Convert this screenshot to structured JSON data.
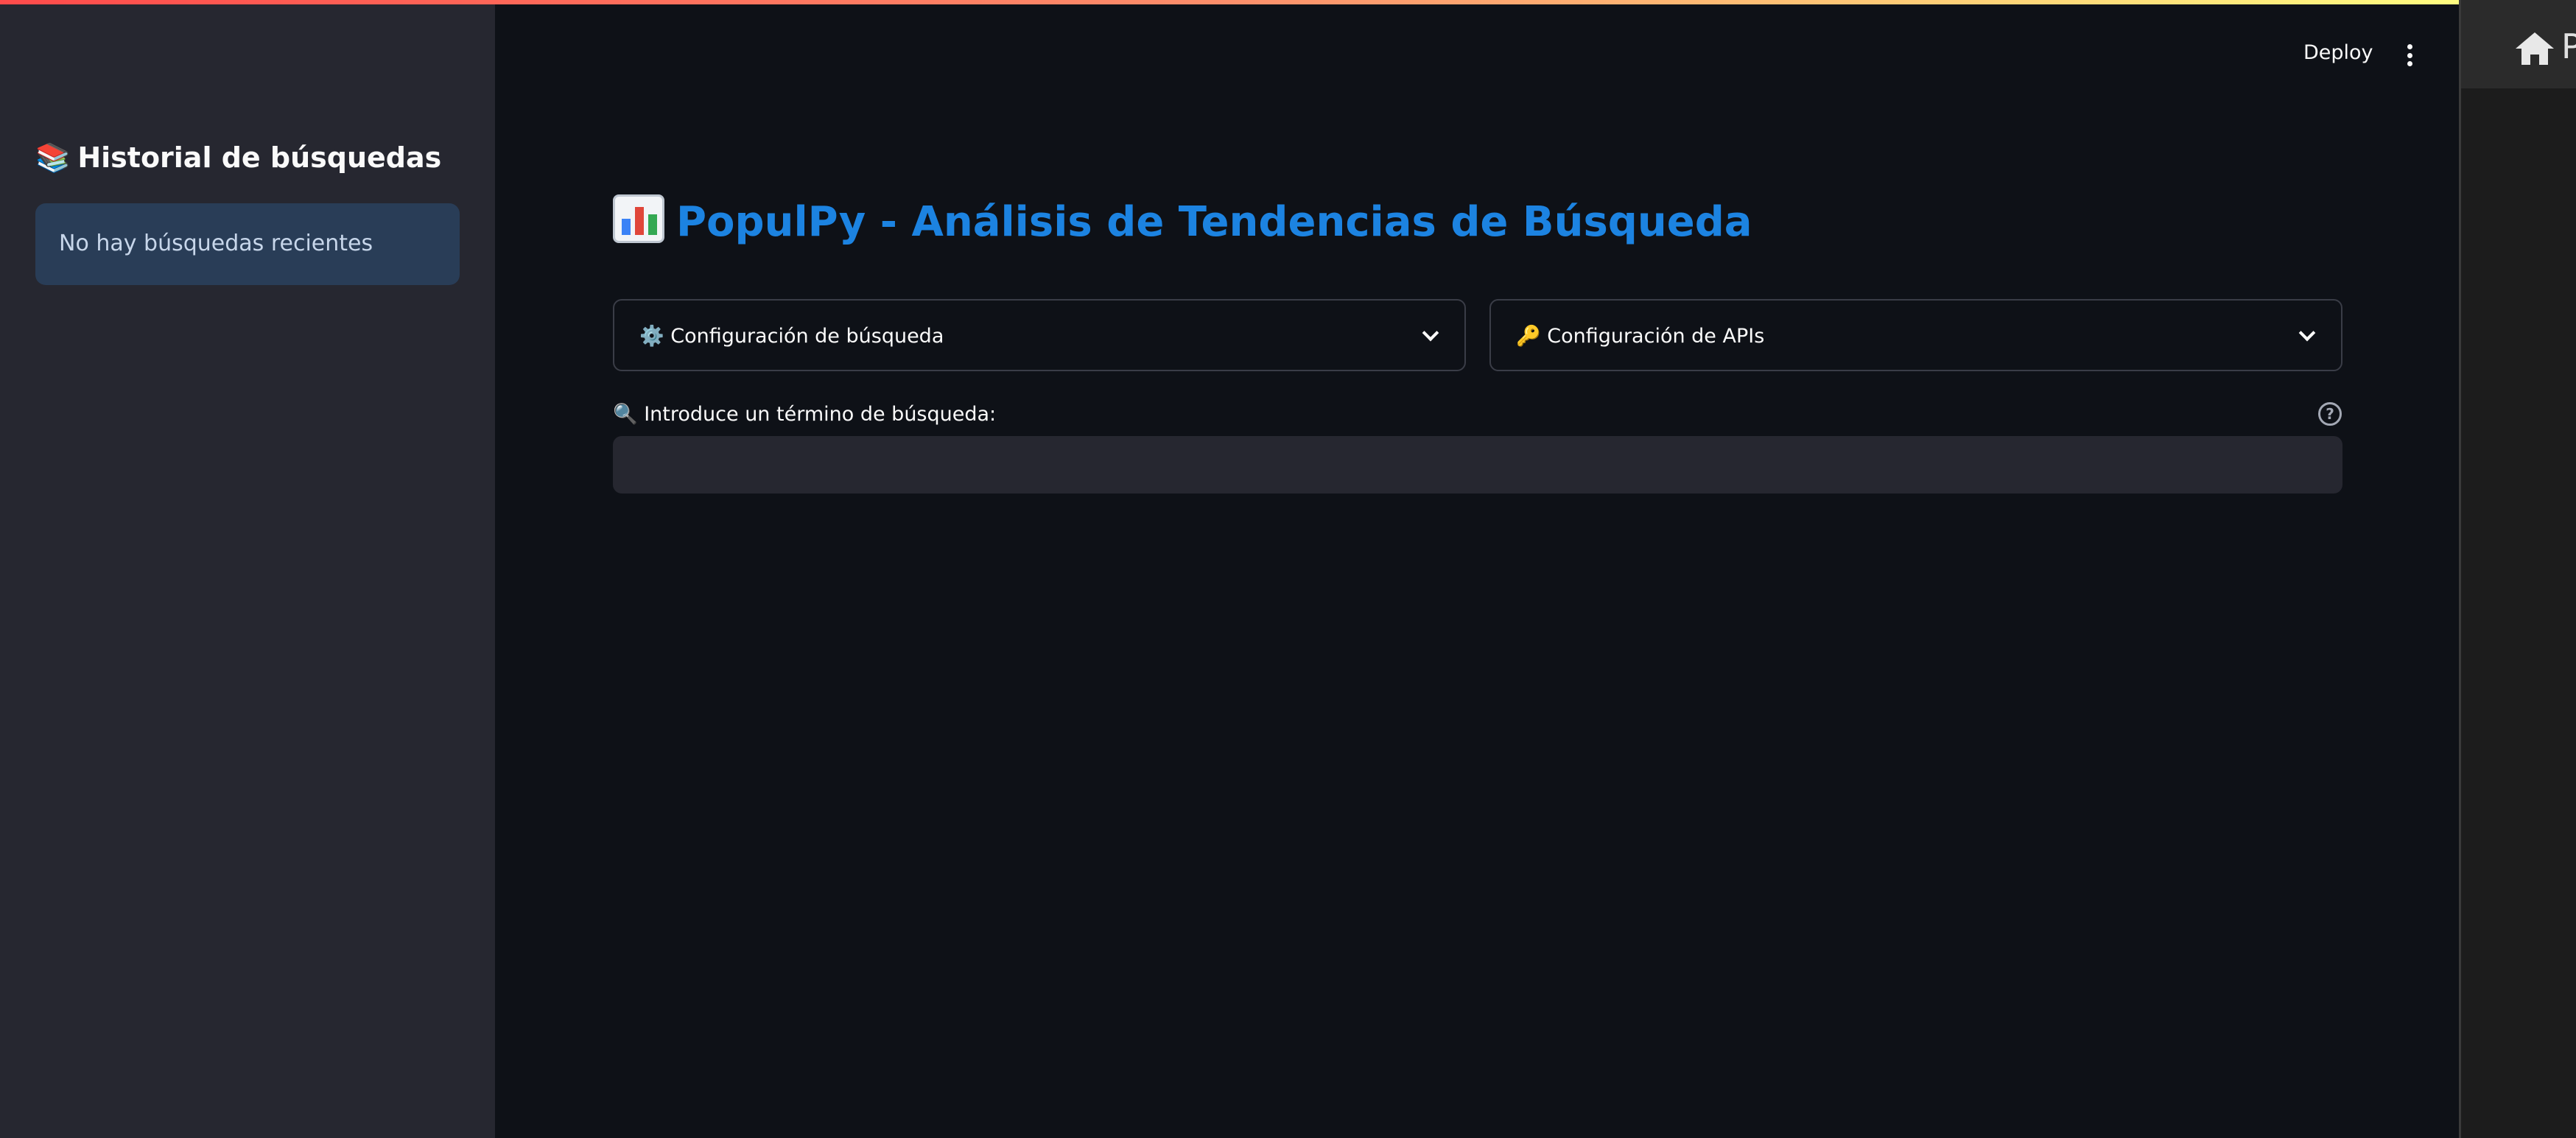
{
  "sidebar": {
    "title_emoji": "📚",
    "title": "Historial de búsquedas",
    "empty_message": "No hay búsquedas recientes"
  },
  "header": {
    "deploy_label": "Deploy",
    "menu_icon": "kebab-menu-icon"
  },
  "main": {
    "title": "PopulPy - Análisis de Tendencias de Búsqueda",
    "expanders": [
      {
        "emoji": "⚙️",
        "label": "Configuración de búsqueda"
      },
      {
        "emoji": "🔑",
        "label": "Configuración de APIs"
      }
    ],
    "search": {
      "emoji": "🔍",
      "label": "Introduce un término de búsqueda:",
      "value": "",
      "placeholder": ""
    }
  },
  "right_panel": {
    "label_fragment": "P"
  },
  "colors": {
    "accent": "#1c83e1",
    "sidebar_bg": "#262730",
    "main_bg": "#0e1117",
    "info_bg": "#293d57"
  }
}
